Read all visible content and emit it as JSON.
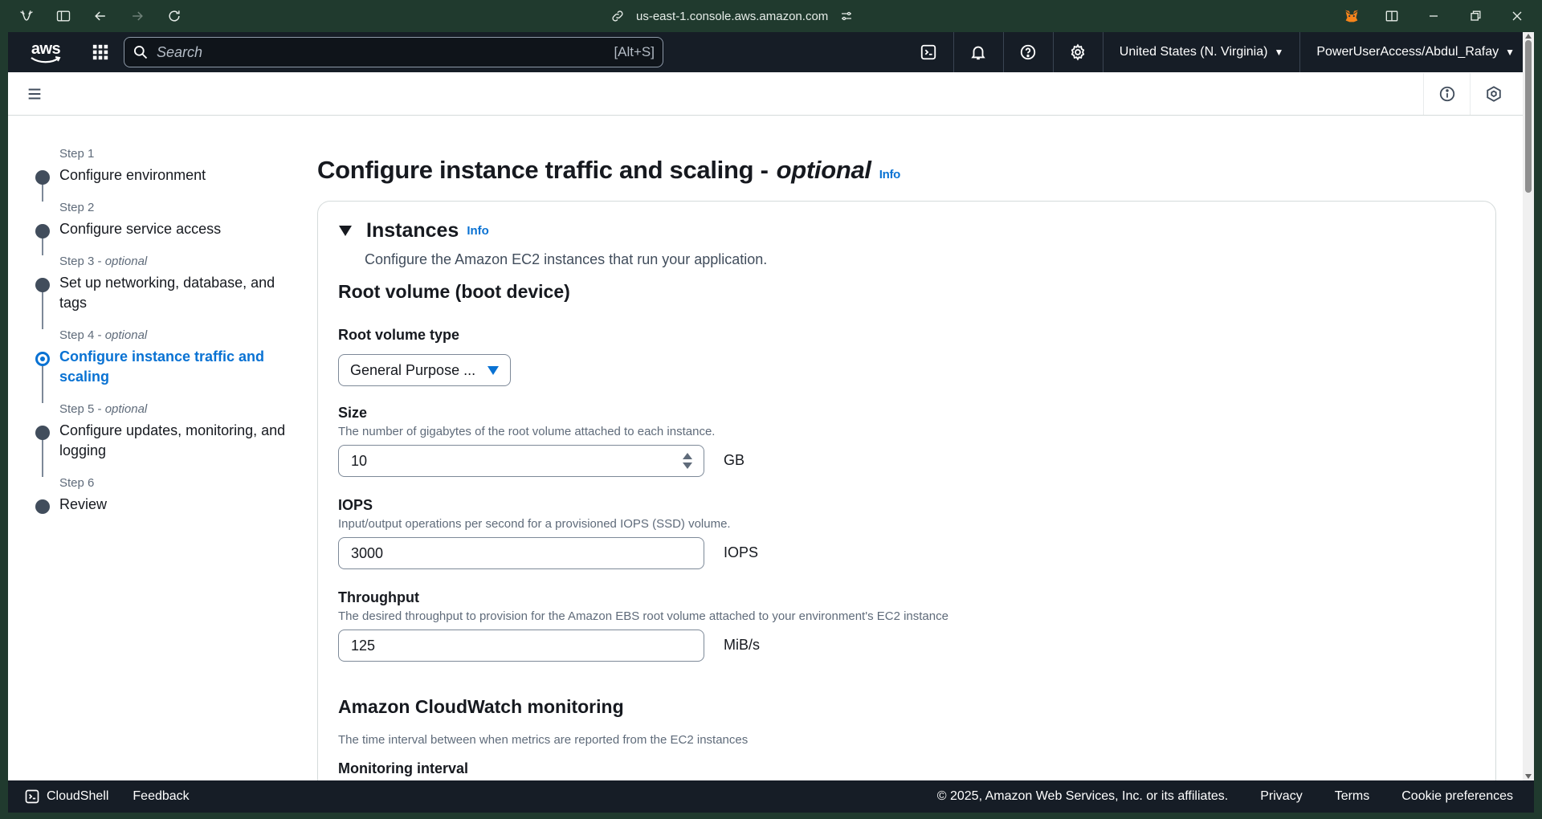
{
  "browser": {
    "url": "us-east-1.console.aws.amazon.com"
  },
  "topnav": {
    "logo_text": "aws",
    "search_placeholder": "Search",
    "search_shortcut": "[Alt+S]",
    "region": "United States (N. Virginia)",
    "account": "PowerUserAccess/Abdul_Rafay"
  },
  "steps": [
    {
      "num": "Step 1",
      "optional": "",
      "title": "Configure environment"
    },
    {
      "num": "Step 2",
      "optional": "",
      "title": "Configure service access"
    },
    {
      "num": "Step 3 - ",
      "optional": "optional",
      "title": "Set up networking, database, and tags"
    },
    {
      "num": "Step 4 - ",
      "optional": "optional",
      "title": "Configure instance traffic and scaling"
    },
    {
      "num": "Step 5 - ",
      "optional": "optional",
      "title": "Configure updates, monitoring, and logging"
    },
    {
      "num": "Step 6",
      "optional": "",
      "title": "Review"
    }
  ],
  "page": {
    "title_main": "Configure instance traffic and scaling -",
    "title_optional": "optional",
    "info": "Info"
  },
  "panel": {
    "title": "Instances",
    "info": "Info",
    "description": "Configure the Amazon EC2 instances that run your application.",
    "root_volume_heading": "Root volume (boot device)",
    "root_volume_type_label": "Root volume type",
    "root_volume_type_value": "General Purpose ...",
    "size_label": "Size",
    "size_desc": "The number of gigabytes of the root volume attached to each instance.",
    "size_value": "10",
    "size_unit": "GB",
    "iops_label": "IOPS",
    "iops_desc": "Input/output operations per second for a provisioned IOPS (SSD) volume.",
    "iops_value": "3000",
    "iops_unit": "IOPS",
    "throughput_label": "Throughput",
    "throughput_desc": "The desired throughput to provision for the Amazon EBS root volume attached to your environment's EC2 instance",
    "throughput_value": "125",
    "throughput_unit": "MiB/s",
    "cloudwatch_heading": "Amazon CloudWatch monitoring",
    "cloudwatch_desc": "The time interval between when metrics are reported from the EC2 instances",
    "monitoring_interval_label": "Monitoring interval"
  },
  "footer": {
    "cloudshell": "CloudShell",
    "feedback": "Feedback",
    "copyright": "© 2025, Amazon Web Services, Inc. or its affiliates.",
    "privacy": "Privacy",
    "terms": "Terms",
    "cookies": "Cookie preferences"
  },
  "colors": {
    "accent": "#0972d3",
    "nav_bg": "#161d26",
    "browser_bg": "#203a2e"
  }
}
